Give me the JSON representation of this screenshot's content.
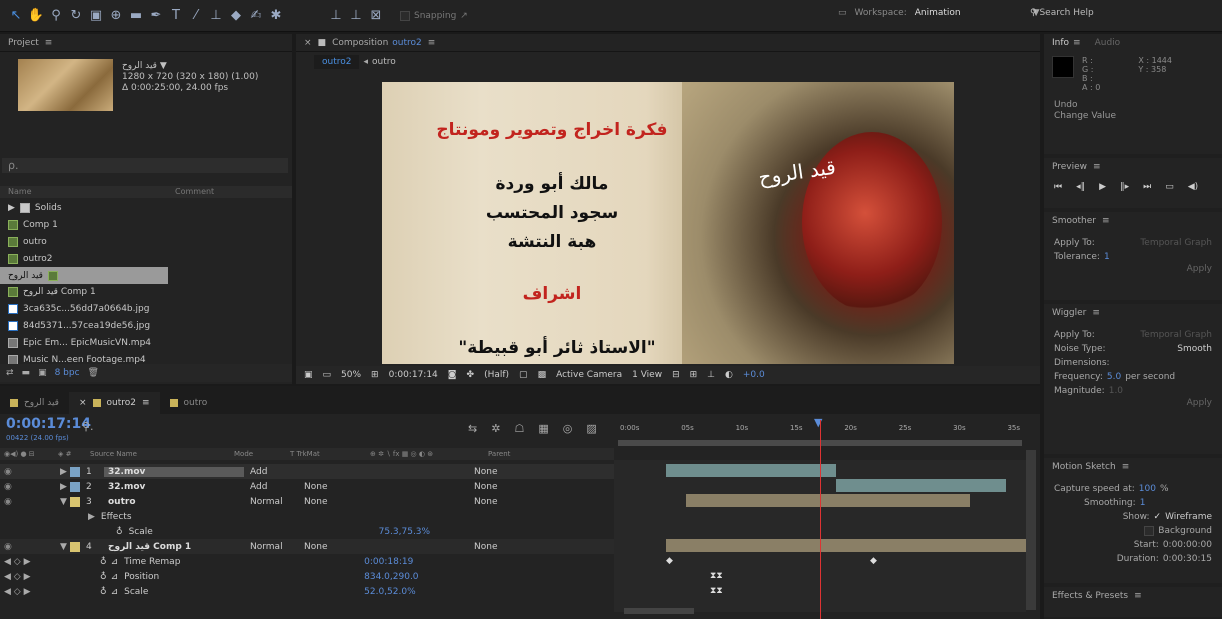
{
  "toolbar": {
    "snapping_label": "Snapping",
    "workspace_label": "Workspace:",
    "workspace_value": "Animation",
    "search_label": "Search Help",
    "icons": [
      "selection-tool",
      "hand-tool",
      "zoom-tool",
      "rotate-tool",
      "camera-tool",
      "pan-behind-tool",
      "rectangle-tool",
      "pen-tool",
      "type-tool",
      "brush-tool",
      "clone-stamp-tool",
      "eraser-tool",
      "roto-brush-tool",
      "puppet-tool"
    ]
  },
  "project": {
    "title": "Project",
    "selected_name": "قيد الروح ▼",
    "selected_dims": "1280 x 720  (320 x 180) (1.00)",
    "selected_duration": "Δ 0:00:25:00, 24.00 fps",
    "search_placeholder": "⍴.",
    "col_name": "Name",
    "col_comment": "Comment",
    "items": [
      {
        "label": "Solids",
        "type": "folder"
      },
      {
        "label": "Comp 1",
        "type": "comp"
      },
      {
        "label": "outro",
        "type": "comp"
      },
      {
        "label": "outro2",
        "type": "comp"
      },
      {
        "label": "قيد الروح",
        "type": "comp",
        "selected": true
      },
      {
        "label": "قيد الروح Comp 1",
        "type": "comp"
      },
      {
        "label": "3ca635c...56dd7a0664b.jpg",
        "type": "jpg"
      },
      {
        "label": "84d5371...57cea19de56.jpg",
        "type": "jpg"
      },
      {
        "label": "Epic Em... EpicMusicVN.mp4",
        "type": "mp4"
      },
      {
        "label": "Music N...een Footage.mp4",
        "type": "mp4"
      }
    ],
    "bpc": "8 bpc"
  },
  "composition": {
    "title": "Composition",
    "comp_name": "outro2",
    "tab_active": "outro2",
    "tab_next": "outro",
    "text_line1": "فكرة اخراج وتصوير ومونتاج",
    "text_line2": "مالك أبو وردة",
    "text_line3": "سجود المحتسب",
    "text_line4": "هبة النتشة",
    "text_line5": "اشراف",
    "text_line6": "\"الاستاذ ثائر أبو قبيطة\"",
    "title_art": "قيد الروح",
    "zoom": "50%",
    "timecode": "0:00:17:14",
    "resolution": "(Half)",
    "camera": "Active Camera",
    "views": "1 View",
    "exposure": "+0.0"
  },
  "info": {
    "tab_info": "Info",
    "tab_audio": "Audio",
    "r": "R :",
    "g": "G :",
    "b": "B :",
    "a": "A : 0",
    "x": "X : 1444",
    "y": "Y : 358",
    "undo": "Undo",
    "change": "Change Value"
  },
  "preview": {
    "title": "Preview"
  },
  "smoother": {
    "title": "Smoother",
    "apply_to_label": "Apply To:",
    "apply_to_value": "Temporal Graph",
    "tolerance_label": "Tolerance:",
    "tolerance_value": "1",
    "apply": "Apply"
  },
  "wiggler": {
    "title": "Wiggler",
    "apply_to_label": "Apply To:",
    "apply_to_value": "Temporal Graph",
    "noise_label": "Noise Type:",
    "noise_value": "Smooth",
    "dims_label": "Dimensions:",
    "freq_label": "Frequency:",
    "freq_value": "5.0",
    "freq_unit": "per second",
    "mag_label": "Magnitude:",
    "mag_value": "1.0",
    "apply": "Apply"
  },
  "motion_sketch": {
    "title": "Motion Sketch",
    "capture_label": "Capture speed at:",
    "capture_value": "100",
    "capture_unit": "%",
    "smoothing_label": "Smoothing:",
    "smoothing_value": "1",
    "show_label": "Show:",
    "wireframe": "Wireframe",
    "background": "Background",
    "start_label": "Start:",
    "start_value": "0:00:00:00",
    "duration_label": "Duration:",
    "duration_value": "0:00:30:15"
  },
  "effects_presets": {
    "title": "Effects & Presets"
  },
  "timeline": {
    "tabs": [
      "قيد الروح",
      "outro2",
      "outro"
    ],
    "active_tab": "outro2",
    "timecode": "0:00:17:14",
    "timecode_sub": "00422 (24.00 fps)",
    "col_source": "Source Name",
    "col_mode": "Mode",
    "col_trk": "T  TrkMat",
    "col_parent": "Parent",
    "ruler": [
      "0:00s",
      "05s",
      "10s",
      "15s",
      "20s",
      "25s",
      "30s",
      "35s"
    ],
    "layers": [
      {
        "num": "1",
        "name": "32.mov",
        "mode": "Add",
        "trk": "",
        "parent": "None"
      },
      {
        "num": "2",
        "name": "32.mov",
        "mode": "Add",
        "trk": "None",
        "parent": "None"
      },
      {
        "num": "3",
        "name": "outro",
        "mode": "Normal",
        "trk": "None",
        "parent": "None"
      },
      {
        "num": "4",
        "name": "قيد الروح Comp 1",
        "mode": "Normal",
        "trk": "None",
        "parent": "None"
      }
    ],
    "effects_label": "Effects",
    "scale_label": "Scale",
    "scale_value_3": "75.3,75.3%",
    "time_remap_label": "Time Remap",
    "time_remap_value": "0:00:18:19",
    "position_label": "Position",
    "position_value": "834.0,290.0",
    "scale_value_4": "52.0,52.0%"
  }
}
